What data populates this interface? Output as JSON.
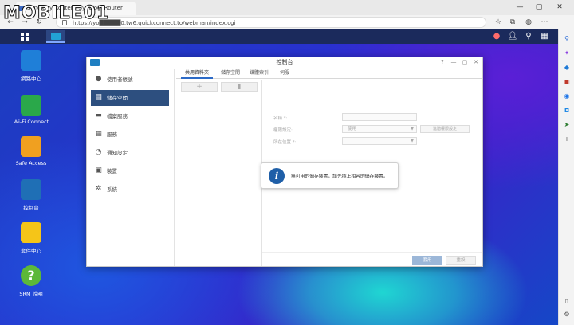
{
  "browser": {
    "tab_title": "Synology Router - SynologyRouter",
    "url": "https://yo█████0.tw6.quickconnect.to/webman/index.cgi",
    "watermark": "MOBILE01"
  },
  "desktop": {
    "icons": [
      {
        "label": "網路中心",
        "icon": "network-center-icon",
        "color": "#1f7fd8"
      },
      {
        "label": "Wi-Fi Connect",
        "icon": "wifi-icon",
        "color": "#2aa84a"
      },
      {
        "label": "Safe Access",
        "icon": "safe-access-icon",
        "color": "#f0a020"
      },
      {
        "label": "控制台",
        "icon": "control-panel-icon",
        "color": "#1f6fb5"
      },
      {
        "label": "套件中心",
        "icon": "package-center-icon",
        "color": "#f5c518"
      },
      {
        "label": "SRM 說明",
        "icon": "help-icon",
        "color": "#5cb83a"
      }
    ]
  },
  "window": {
    "title": "控制台",
    "sidebar": [
      {
        "label": "使用者帳號",
        "icon": "user-icon"
      },
      {
        "label": "儲存空間",
        "icon": "storage-icon"
      },
      {
        "label": "檔案服務",
        "icon": "file-service-icon"
      },
      {
        "label": "服務",
        "icon": "services-icon"
      },
      {
        "label": "通知設定",
        "icon": "notification-icon"
      },
      {
        "label": "裝置",
        "icon": "device-icon"
      },
      {
        "label": "系統",
        "icon": "system-icon"
      }
    ],
    "active_sidebar": "儲存空間",
    "tabs": [
      {
        "label": "共用資料夾"
      },
      {
        "label": "儲存空間"
      },
      {
        "label": "媒體索引"
      },
      {
        "label": "伺服"
      }
    ],
    "active_tab": "共用資料夾",
    "form": {
      "name_label": "名稱 *:",
      "desc_label": "權限設定:",
      "desc_value": "使用",
      "location_label": "所在位置 *:",
      "side_button": "進階權限設定"
    },
    "ok_button": "套用",
    "cancel_button": "重設"
  },
  "toast": {
    "message": "無可用的儲存裝置，請先插上相容的儲存裝置。"
  }
}
